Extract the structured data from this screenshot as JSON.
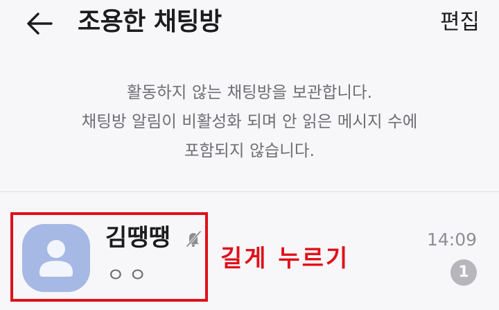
{
  "header": {
    "back_icon": "arrow-left-icon",
    "title": "조용한 채팅방",
    "edit_label": "편집"
  },
  "info": {
    "lines": [
      "활동하지 않는 채팅방을 보관합니다.",
      "채팅방 알림이 비활성화 되며 안 읽은 메시지 수에",
      "포함되지 않습니다."
    ]
  },
  "chats": [
    {
      "avatar_icon": "default-person-icon",
      "name": "김땡땡",
      "muted_icon": "bell-off-icon",
      "preview": "ㅇㅇ",
      "time": "14:09",
      "unread": "1"
    }
  ],
  "annotation": {
    "text": "길게 누르기",
    "color": "#e0101a"
  },
  "colors": {
    "background": "#f7f7f9",
    "avatar": "#a6b8e4",
    "badge": "#b6b6bb"
  }
}
